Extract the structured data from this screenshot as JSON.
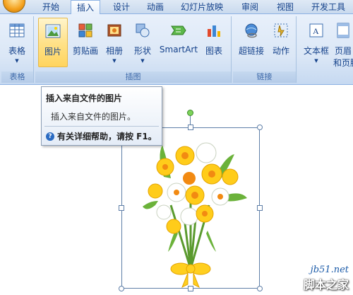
{
  "tabs": [
    {
      "label": "开始"
    },
    {
      "label": "插入",
      "active": true
    },
    {
      "label": "设计"
    },
    {
      "label": "动画"
    },
    {
      "label": "幻灯片放映"
    },
    {
      "label": "审阅"
    },
    {
      "label": "视图"
    },
    {
      "label": "开发工具"
    }
  ],
  "ribbon": {
    "groups": {
      "tables": {
        "label": "表格",
        "buttons": [
          {
            "label": "表格",
            "icon": "table-icon"
          }
        ]
      },
      "illustrations": {
        "label": "插图",
        "buttons": [
          {
            "label": "图片",
            "icon": "picture-icon",
            "highlighted": true
          },
          {
            "label": "剪贴画",
            "icon": "clipart-icon"
          },
          {
            "label": "相册",
            "icon": "photo-album-icon"
          },
          {
            "label": "形状",
            "icon": "shapes-icon"
          },
          {
            "label": "SmartArt",
            "icon": "smartart-icon"
          },
          {
            "label": "图表",
            "icon": "chart-icon"
          }
        ]
      },
      "links": {
        "label": "链接",
        "buttons": [
          {
            "label": "超链接",
            "icon": "hyperlink-icon"
          },
          {
            "label": "动作",
            "icon": "action-icon"
          }
        ]
      },
      "text": {
        "buttons": [
          {
            "label": "文本框",
            "icon": "textbox-icon"
          },
          {
            "label_line1": "页眉",
            "label_line2": "和页脚",
            "icon": "header-footer-icon"
          }
        ]
      }
    }
  },
  "tooltip": {
    "title": "插入来自文件的图片",
    "description": "插入来自文件的图片。",
    "help": "有关详细帮助，请按 F1。"
  },
  "watermark": {
    "line1": "jb51.net",
    "line2": "脚本之家"
  },
  "colors": {
    "accent": "#15428b",
    "ribbon_bg": "#dbe7f6",
    "highlight": "#ffe28a",
    "selection": "#5f7fa8",
    "rotation_handle": "#7dd35a"
  }
}
